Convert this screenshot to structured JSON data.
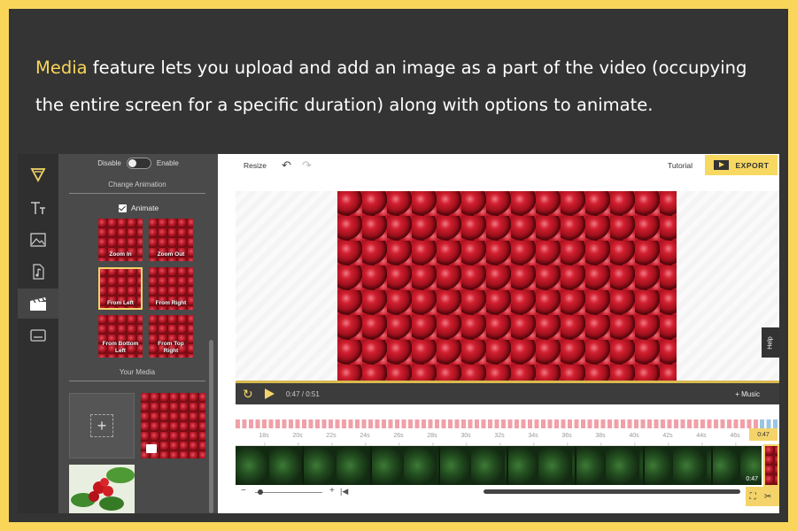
{
  "caption": {
    "highlight": "Media",
    "text": " feature lets you upload and add an image as a part of the video (occupying the entire screen for a specific duration) along with options to animate."
  },
  "rail": {
    "icons": [
      "logo-icon",
      "text-icon",
      "image-icon",
      "music-icon",
      "media-icon",
      "subtitle-icon"
    ],
    "active": "media-icon"
  },
  "panel": {
    "toggle": {
      "off_label": "Disable",
      "on_label": "Enable"
    },
    "change_animation": "Change Animation",
    "animate_label": "Animate",
    "tiles": [
      "Zoom In",
      "Zoom Out",
      "From Left",
      "From Right",
      "From Bottom Left",
      "From Top Right"
    ],
    "selected_tile": "From Left",
    "your_media": "Your Media"
  },
  "topbar": {
    "resize": "Resize",
    "tutorial": "Tutorial",
    "export": "EXPORT"
  },
  "player": {
    "time": "0:47 / 0:51",
    "music": "+ Music",
    "help": "Help"
  },
  "timeline": {
    "ticks": [
      "18s",
      "20s",
      "22s",
      "24s",
      "26s",
      "28s",
      "30s",
      "32s",
      "34s",
      "36s",
      "38s",
      "40s",
      "42s",
      "44s",
      "46s"
    ],
    "marker": "0:47",
    "end_time": "0:47"
  },
  "colors": {
    "accent": "#f4d46a",
    "background": "#343434",
    "border": "#f9d65a"
  }
}
